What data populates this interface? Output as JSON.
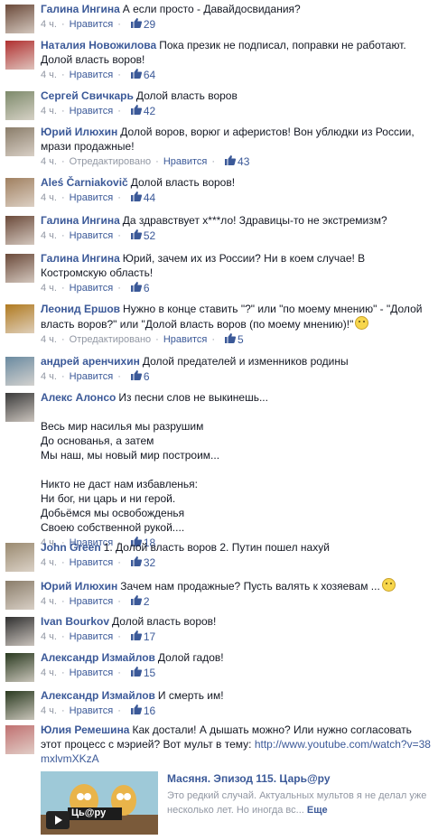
{
  "labels": {
    "like": "Нравится",
    "edited": "Отредактировано",
    "more": "Еще"
  },
  "comments": [
    {
      "author": "Галина Ингина",
      "text": "А если просто - Давайдосвидания?",
      "time": "4 ч.",
      "likes": "29",
      "avatar": "#6b4a3a"
    },
    {
      "author": "Наталия Новожилова",
      "text": "Пока презик не подписал, поправки не работают. Долой власть воров!",
      "time": "4 ч.",
      "likes": "64",
      "avatar": "#b03030"
    },
    {
      "author": "Сергей Свичкарь",
      "text": "Долой власть воров",
      "time": "4 ч.",
      "likes": "42",
      "avatar": "#7d8a6b"
    },
    {
      "author": "Юрий Илюхин",
      "text": "Долой воров, ворюг и аферистов! Вон ублюдки из России, мрази продажные!",
      "time": "4 ч.",
      "edited": true,
      "likes": "43",
      "avatar": "#8a7d6a"
    },
    {
      "author": "Aleś Čarniakovič",
      "text": "Долой власть воров!",
      "time": "4 ч.",
      "likes": "44",
      "avatar": "#a08060"
    },
    {
      "author": "Галина Ингина",
      "text": "Да здравствует х***ло! Здравицы-то не экстремизм?",
      "time": "4 ч.",
      "likes": "52",
      "avatar": "#6b4a3a"
    },
    {
      "author": "Галина Ингина",
      "text": "Юрий, зачем их из России? Ни в коем случае! В Костромскую область!",
      "time": "4 ч.",
      "likes": "6",
      "avatar": "#6b4a3a"
    },
    {
      "author": "Леонид Ершов",
      "text": "Нужно в конце ставить \"?\" или \"по моему мнению\" - \"Долой власть воров?\" или \"Долой власть воров (по моему мнению)!\"",
      "smile": true,
      "time": "4 ч.",
      "edited": true,
      "likes": "5",
      "avatar": "#b07a20"
    },
    {
      "author": "андрей аренчихин",
      "text": "Долой предателей и изменников родины",
      "time": "4 ч.",
      "likes": "6",
      "avatar": "#6a8aa0"
    },
    {
      "author": "Алекс Алонсо",
      "text": "Из песни слов не выкинешь...\n\nВесь мир насилья мы разрушим\nДо основанья, а затем\nМы наш, мы новый мир построим...\n\nНикто не даст нам избавленья:\nНи бог, ни царь и ни герой.\nДобьёмся мы освобожденья\nСвоею собственной рукой....",
      "time": "4 ч.",
      "likes": "18",
      "avatar": "#3a3a3a"
    },
    {
      "author": "John Green",
      "text": "1. Долой власть воров 2. Путин пошел нахуй",
      "time": "4 ч.",
      "likes": "32",
      "avatar": "#9a8a70"
    },
    {
      "author": "Юрий Илюхин",
      "text": "Зачем нам продажные? Пусть валять к хозяевам ...",
      "smile": true,
      "time": "4 ч.",
      "likes": "2",
      "avatar": "#8a7d6a"
    },
    {
      "author": "Ivan Bourkov",
      "text": "Долой власть воров!",
      "time": "4 ч.",
      "likes": "17",
      "avatar": "#303030"
    },
    {
      "author": "Александр Измайлов",
      "text": "Долой гадов!",
      "time": "4 ч.",
      "likes": "15",
      "avatar": "#2a3a20"
    },
    {
      "author": "Александр Измайлов",
      "text": "И смерть им!",
      "time": "4 ч.",
      "likes": "16",
      "avatar": "#2a3a20"
    },
    {
      "author": "Юлия Ремешина",
      "text": "Как достали! А дышать можно? Или нужно согласовать этот процесс с мэрией? Вот мульт в тему: ",
      "link": "http://www.youtube.com/watch?v=38mxlvmXKzA",
      "avatar": "#c07070"
    }
  ],
  "preview": {
    "title": "Масяня. Эпизод 115. Царь@ру",
    "desc": "Это редкий случай. Актуальных мультов я не делал уже несколько лет. Но иногда вс...",
    "thumb_text": "Ць@ру"
  },
  "colors": {
    "link": "#3b5998",
    "meta": "#9197a3"
  }
}
